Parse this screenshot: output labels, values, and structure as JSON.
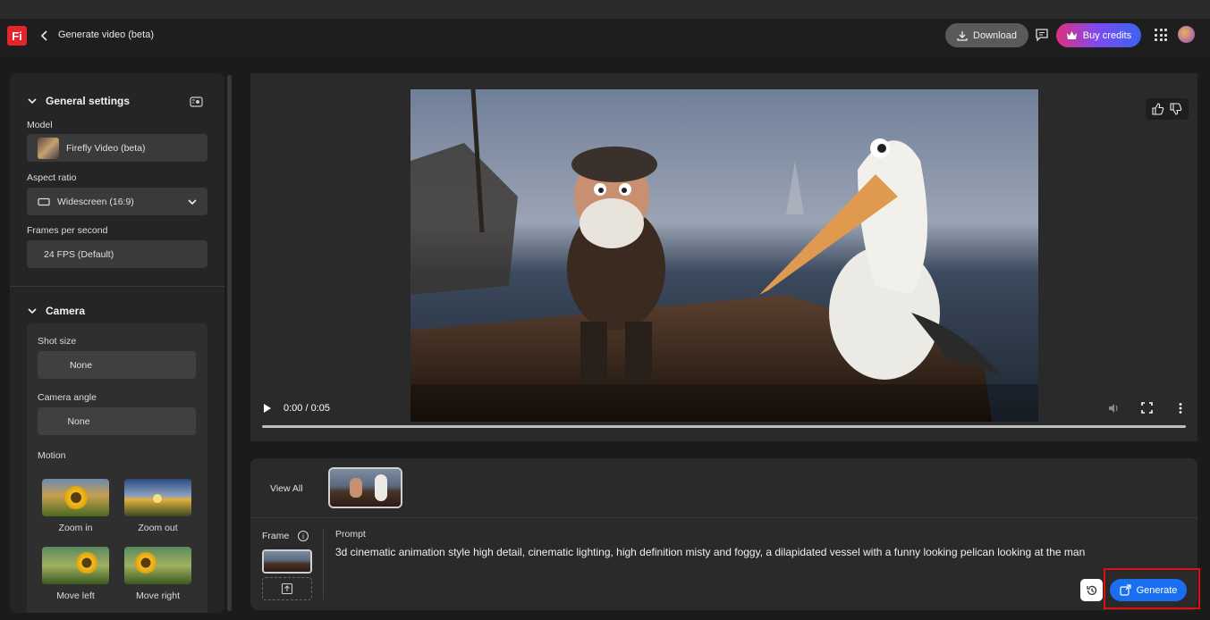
{
  "app": {
    "logo_text": "Fi",
    "page_title": "Generate video (beta)",
    "accent_color": "#1a6ef0",
    "brand_color": "#e3242b"
  },
  "header": {
    "download_label": "Download",
    "buy_credits_label": "Buy credits"
  },
  "sidebar": {
    "general_settings_title": "General settings",
    "model_label": "Model",
    "model_value": "Firefly Video (beta)",
    "aspect_ratio_label": "Aspect ratio",
    "aspect_ratio_value": "Widescreen (16:9)",
    "fps_label": "Frames per second",
    "fps_value": "24 FPS (Default)",
    "camera_title": "Camera",
    "shot_size_label": "Shot size",
    "shot_size_value": "None",
    "camera_angle_label": "Camera angle",
    "camera_angle_value": "None",
    "motion_label": "Motion",
    "motion_items": [
      {
        "label": "Zoom in"
      },
      {
        "label": "Zoom out"
      },
      {
        "label": "Move left"
      },
      {
        "label": "Move right"
      }
    ]
  },
  "video": {
    "time_display": "0:00 / 0:05",
    "progress": 0
  },
  "bottom": {
    "view_all_label": "View All",
    "frame_label": "Frame",
    "prompt_label": "Prompt",
    "prompt_text": "3d cinematic animation style high detail, cinematic lighting, high definition misty and foggy, a dilapidated vessel with a funny looking pelican looking at the man",
    "generate_label": "Generate"
  }
}
